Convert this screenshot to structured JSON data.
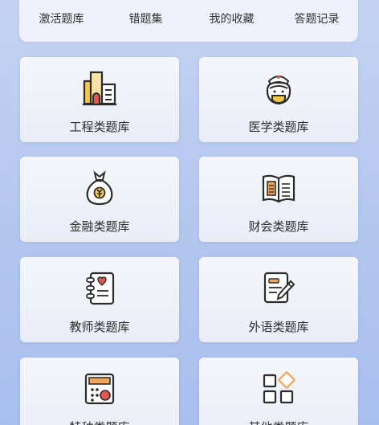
{
  "quick_actions": [
    {
      "label": "激活题库",
      "icon": "shield-icon"
    },
    {
      "label": "错题集",
      "icon": "wrong-questions-icon"
    },
    {
      "label": "我的收藏",
      "icon": "favorites-icon"
    },
    {
      "label": "答题记录",
      "icon": "history-icon"
    }
  ],
  "categories": [
    {
      "label": "工程类题库",
      "icon": "building-icon"
    },
    {
      "label": "医学类题库",
      "icon": "nurse-icon"
    },
    {
      "label": "金融类题库",
      "icon": "money-bag-icon"
    },
    {
      "label": "财会类题库",
      "icon": "open-book-icon"
    },
    {
      "label": "教师类题库",
      "icon": "teacher-notebook-icon"
    },
    {
      "label": "外语类题库",
      "icon": "document-pen-icon"
    },
    {
      "label": "特种类题库",
      "icon": "calculator-icon"
    },
    {
      "label": "其他类题库",
      "icon": "other-grid-icon"
    }
  ],
  "colors": {
    "background_top": "#c4d3f2",
    "background_bottom": "#a9bff0",
    "card": "#eef1f9",
    "icon_stroke": "#2c2c2c",
    "icon_accent_red": "#e0584e",
    "icon_accent_orange": "#f0a55a",
    "icon_accent_yellow": "#f3c84b"
  }
}
